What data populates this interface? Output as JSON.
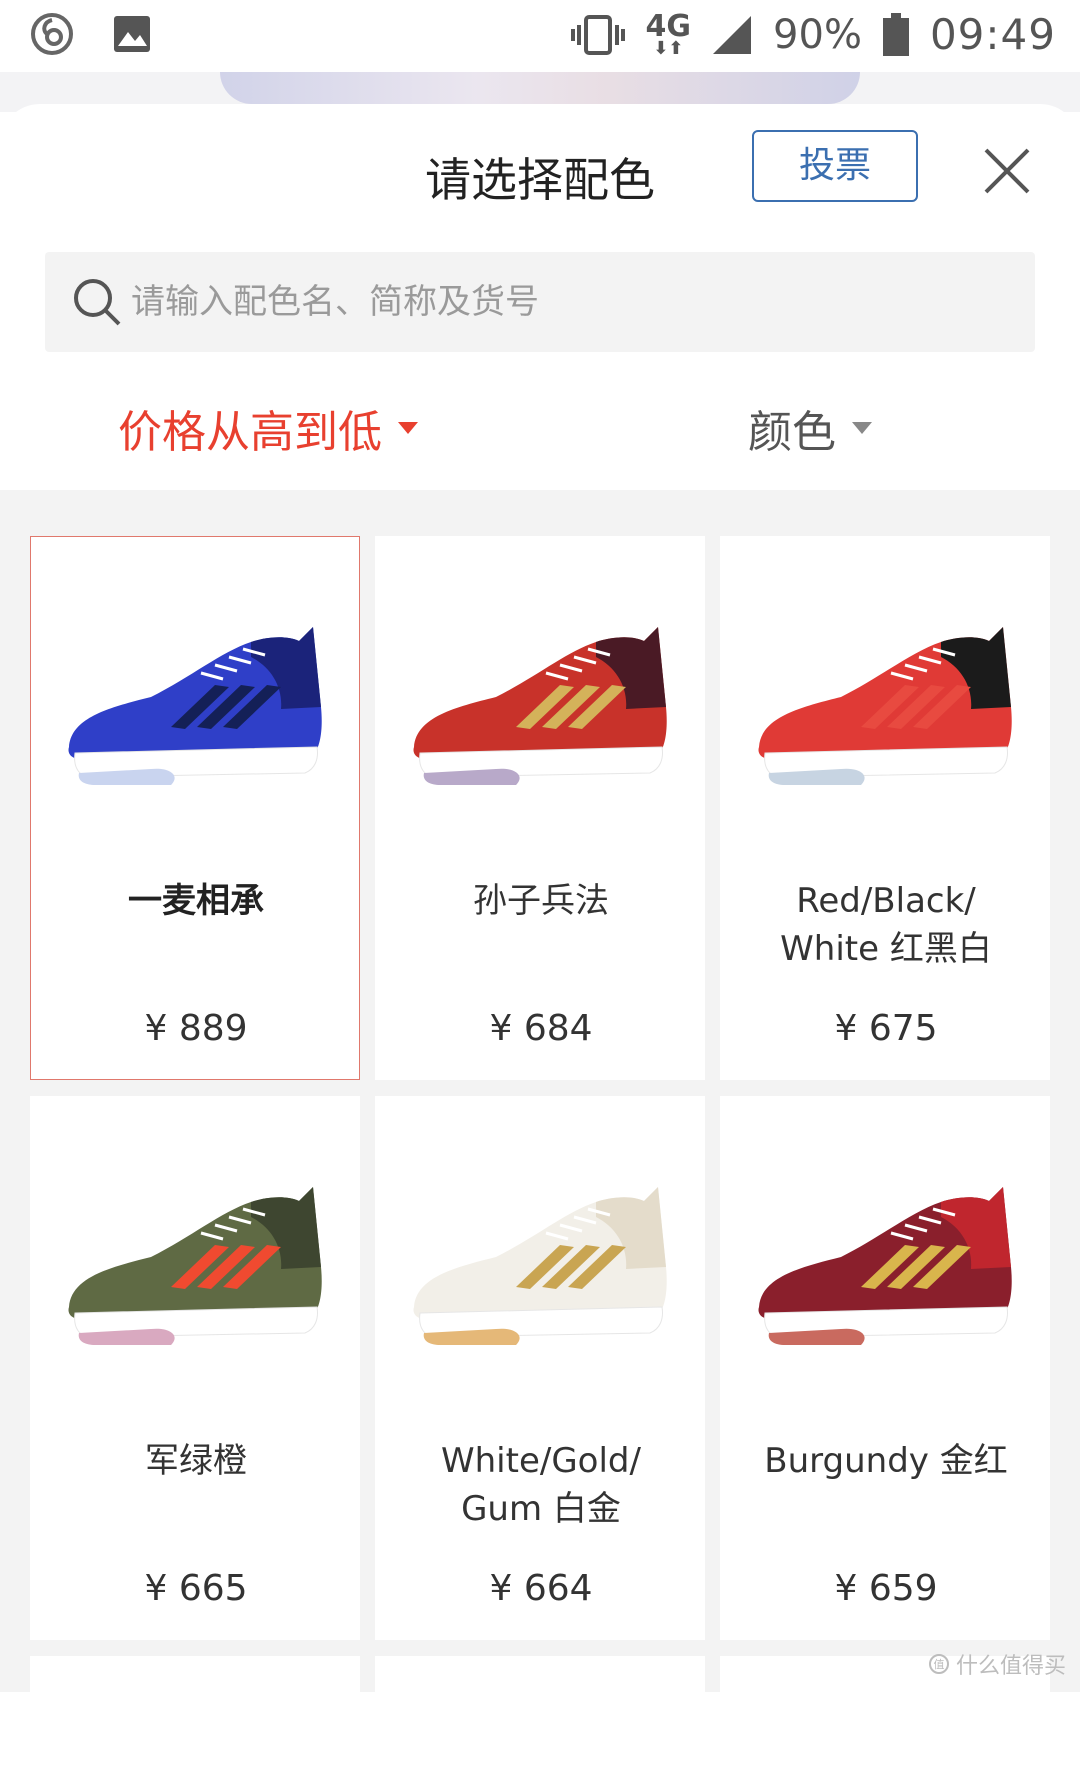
{
  "status_bar": {
    "network": "4G",
    "battery": "90%",
    "time": "09:49"
  },
  "sheet": {
    "title": "请选择配色",
    "vote_label": "投票",
    "search_placeholder": "请输入配色名、简称及货号",
    "sort_label": "价格从高到低",
    "color_filter_label": "颜色"
  },
  "products": [
    {
      "name": "一麦相承",
      "price": "¥ 889",
      "selected": true,
      "colors": {
        "upper": "#2f3fc8",
        "accent": "#1b237a",
        "stripe": "#142057",
        "sole": "#ffffff",
        "outsole": "#c9d4ef"
      }
    },
    {
      "name": "孙子兵法",
      "price": "¥ 684",
      "selected": false,
      "colors": {
        "upper": "#c8322a",
        "accent": "#4a1a25",
        "stripe": "#d4b25a",
        "sole": "#ffffff",
        "outsole": "#b8a9c9"
      }
    },
    {
      "name": "Red/Black/ White 红黑白",
      "price": "¥ 675",
      "selected": false,
      "colors": {
        "upper": "#e03a36",
        "accent": "#1b1b1b",
        "stripe": "#e84a40",
        "sole": "#ffffff",
        "outsole": "#c7d4e2"
      }
    },
    {
      "name": "军绿橙",
      "price": "¥ 665",
      "selected": false,
      "colors": {
        "upper": "#5f6a44",
        "accent": "#3e4630",
        "stripe": "#f04a30",
        "sole": "#ffffff",
        "outsole": "#d9a9c0"
      }
    },
    {
      "name": "White/Gold/ Gum 白金",
      "price": "¥ 664",
      "selected": false,
      "colors": {
        "upper": "#f2efe8",
        "accent": "#e4dccb",
        "stripe": "#c9a552",
        "sole": "#ffffff",
        "outsole": "#e5b878"
      }
    },
    {
      "name": "Burgundy 金红",
      "price": "¥ 659",
      "selected": false,
      "colors": {
        "upper": "#8a1f2c",
        "accent": "#c0262e",
        "stripe": "#d9b54c",
        "sole": "#ffffff",
        "outsole": "#c96a5f"
      }
    }
  ],
  "watermark": "什么值得买"
}
